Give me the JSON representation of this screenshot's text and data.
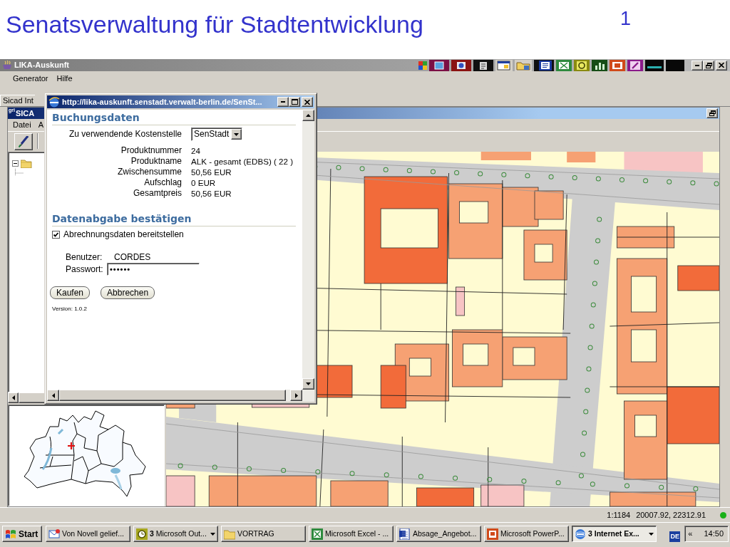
{
  "slide": {
    "title": "Senatsverwaltung für Stadtentwicklung",
    "page_number": "1"
  },
  "app": {
    "title": "LIKA-Auskunft",
    "menu": [
      "Generator",
      "Hilfe"
    ],
    "tab": "Sicad Int"
  },
  "sicad": {
    "logo": "gri",
    "title": "SICA",
    "menu": [
      "Datei",
      "A"
    ],
    "tree_expanded": true
  },
  "status_bar": {
    "scale": "1:1184",
    "coordinates": "20007.92, 22312.91"
  },
  "popup": {
    "title": "http://lika-auskunft.senstadt.verwalt-berlin.de/SenSt...",
    "booking": {
      "heading": "Buchungsdaten",
      "cost_center": {
        "label": "Zu verwendende Kostenstelle",
        "value": "SenStadt"
      },
      "details": [
        {
          "label": "Produktnummer",
          "value": "24"
        },
        {
          "label": "Produktname",
          "value": "ALK - gesamt (EDBS) ( 22 )"
        },
        {
          "label": "Zwischensumme",
          "value": "50,56 EUR"
        },
        {
          "label": "Aufschlag",
          "value": "0 EUR"
        },
        {
          "label": "Gesamtpreis",
          "value": "50,56 EUR"
        }
      ]
    },
    "confirm": {
      "heading": "Datenabgabe bestätigen",
      "checkbox": {
        "label": "Abrechnungsdaten bereitstellen",
        "checked": true
      },
      "user": {
        "label": "Benutzer:",
        "value": "CORDES"
      },
      "password": {
        "label": "Passwort:",
        "value": "••••••"
      }
    },
    "buttons": [
      "Kaufen",
      "Abbrechen"
    ],
    "version": "Version: 1.0.2"
  },
  "taskbar": {
    "start": "Start",
    "tasks": [
      {
        "label": "Von Novell gelief...",
        "selected": false,
        "grouped": false
      },
      {
        "label": "**3** Microsoft Out...",
        "selected": false,
        "grouped": true
      },
      {
        "label": "VORTRAG",
        "selected": false,
        "grouped": false
      },
      {
        "label": "Microsoft Excel - ...",
        "selected": false,
        "grouped": false
      },
      {
        "label": "Absage_Angebot...",
        "selected": false,
        "grouped": false
      },
      {
        "label": "Microsoft PowerP...",
        "selected": false,
        "grouped": false
      },
      {
        "label": "3 Internet Ex...",
        "selected": true,
        "grouped": true
      }
    ],
    "language": "DE",
    "tray_toggle": "«",
    "clock": "14:50"
  }
}
